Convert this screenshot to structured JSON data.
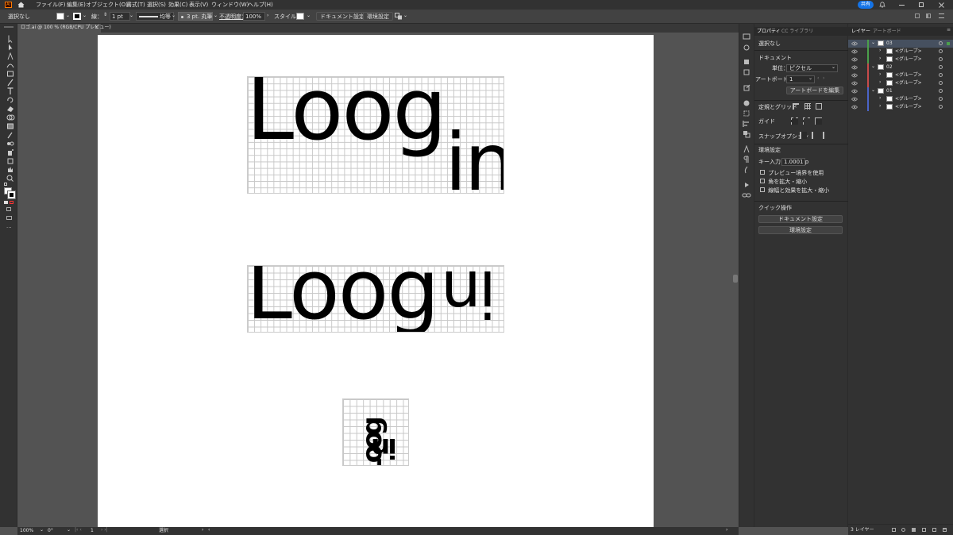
{
  "menubar": {
    "app_badge": "Ai",
    "items": [
      "ファイル(F)",
      "編集(E)",
      "オブジェクト(O)",
      "書式(T)",
      "選択(S)",
      "効果(C)",
      "表示(V)",
      "ウィンドウ(W)",
      "ヘルプ(H)"
    ],
    "share_label": "共有"
  },
  "controlbar": {
    "selection": "選択なし",
    "stroke_label": "線：",
    "stroke_value": "1 pt",
    "profile_label": "均等",
    "brush_value": "3 pt. 丸筆",
    "opacity_label": "不透明度：",
    "opacity_value": "100%",
    "style_label": "スタイル：",
    "doc_settings": "ドキュメント設定",
    "preferences": "環境設定"
  },
  "document_tab": {
    "title": "ロゴ.ai @ 100 % (RGB/CPU プレビュー)"
  },
  "artwork": {
    "a1": {
      "line1": "Loog",
      "line2": "in"
    },
    "a2": {
      "text": "Loog",
      "tail": "in"
    },
    "a3": {
      "text": "Loog",
      "tail": "in"
    }
  },
  "properties_panel": {
    "tabs": [
      "プロパティ",
      "CC ライブラリ"
    ],
    "selection": "選択なし",
    "document_heading": "ドキュメント",
    "unit_label": "単位：",
    "unit_value": "ピクセル",
    "artboard_label": "アートボード：",
    "artboard_value": "1",
    "edit_artboards": "アートボードを編集",
    "rulers_grids": "定規とグリッド",
    "guides": "ガイド",
    "snap_options": "スナップオプション",
    "prefs_heading": "環境設定",
    "key_increment_label": "キー入力：",
    "key_increment_value": "1.0001 p",
    "checkboxes": [
      "プレビュー境界を使用",
      "角を拡大・縮小",
      "線幅と効果を拡大・縮小"
    ],
    "quick_actions": "クイック操作",
    "quick_doc_settings": "ドキュメント設定",
    "quick_preferences": "環境設定"
  },
  "layers_panel": {
    "tabs": [
      "レイヤー",
      "アートボード"
    ],
    "rows": [
      {
        "name": "03",
        "color": "#4b9f4b"
      },
      {
        "name": "<グループ>",
        "color": "#4b9f4b"
      },
      {
        "name": "<グループ>",
        "color": "#4b9f4b"
      },
      {
        "name": "02",
        "color": "#c84b4b"
      },
      {
        "name": "<グループ>",
        "color": "#c84b4b"
      },
      {
        "name": "<グループ>",
        "color": "#c84b4b"
      },
      {
        "name": "01",
        "color": "#4b64c8"
      },
      {
        "name": "<グループ>",
        "color": "#4b64c8"
      },
      {
        "name": "<グループ>",
        "color": "#4b64c8"
      }
    ],
    "count": "3 レイヤー"
  },
  "statusbar": {
    "zoom": "100%",
    "rotation": "0°",
    "page": "1",
    "tool": "選択"
  },
  "colors": {
    "accent": "#1473e6",
    "ui_dark": "#323232",
    "ui_mid": "#535353",
    "artboard": "#ffffff"
  }
}
